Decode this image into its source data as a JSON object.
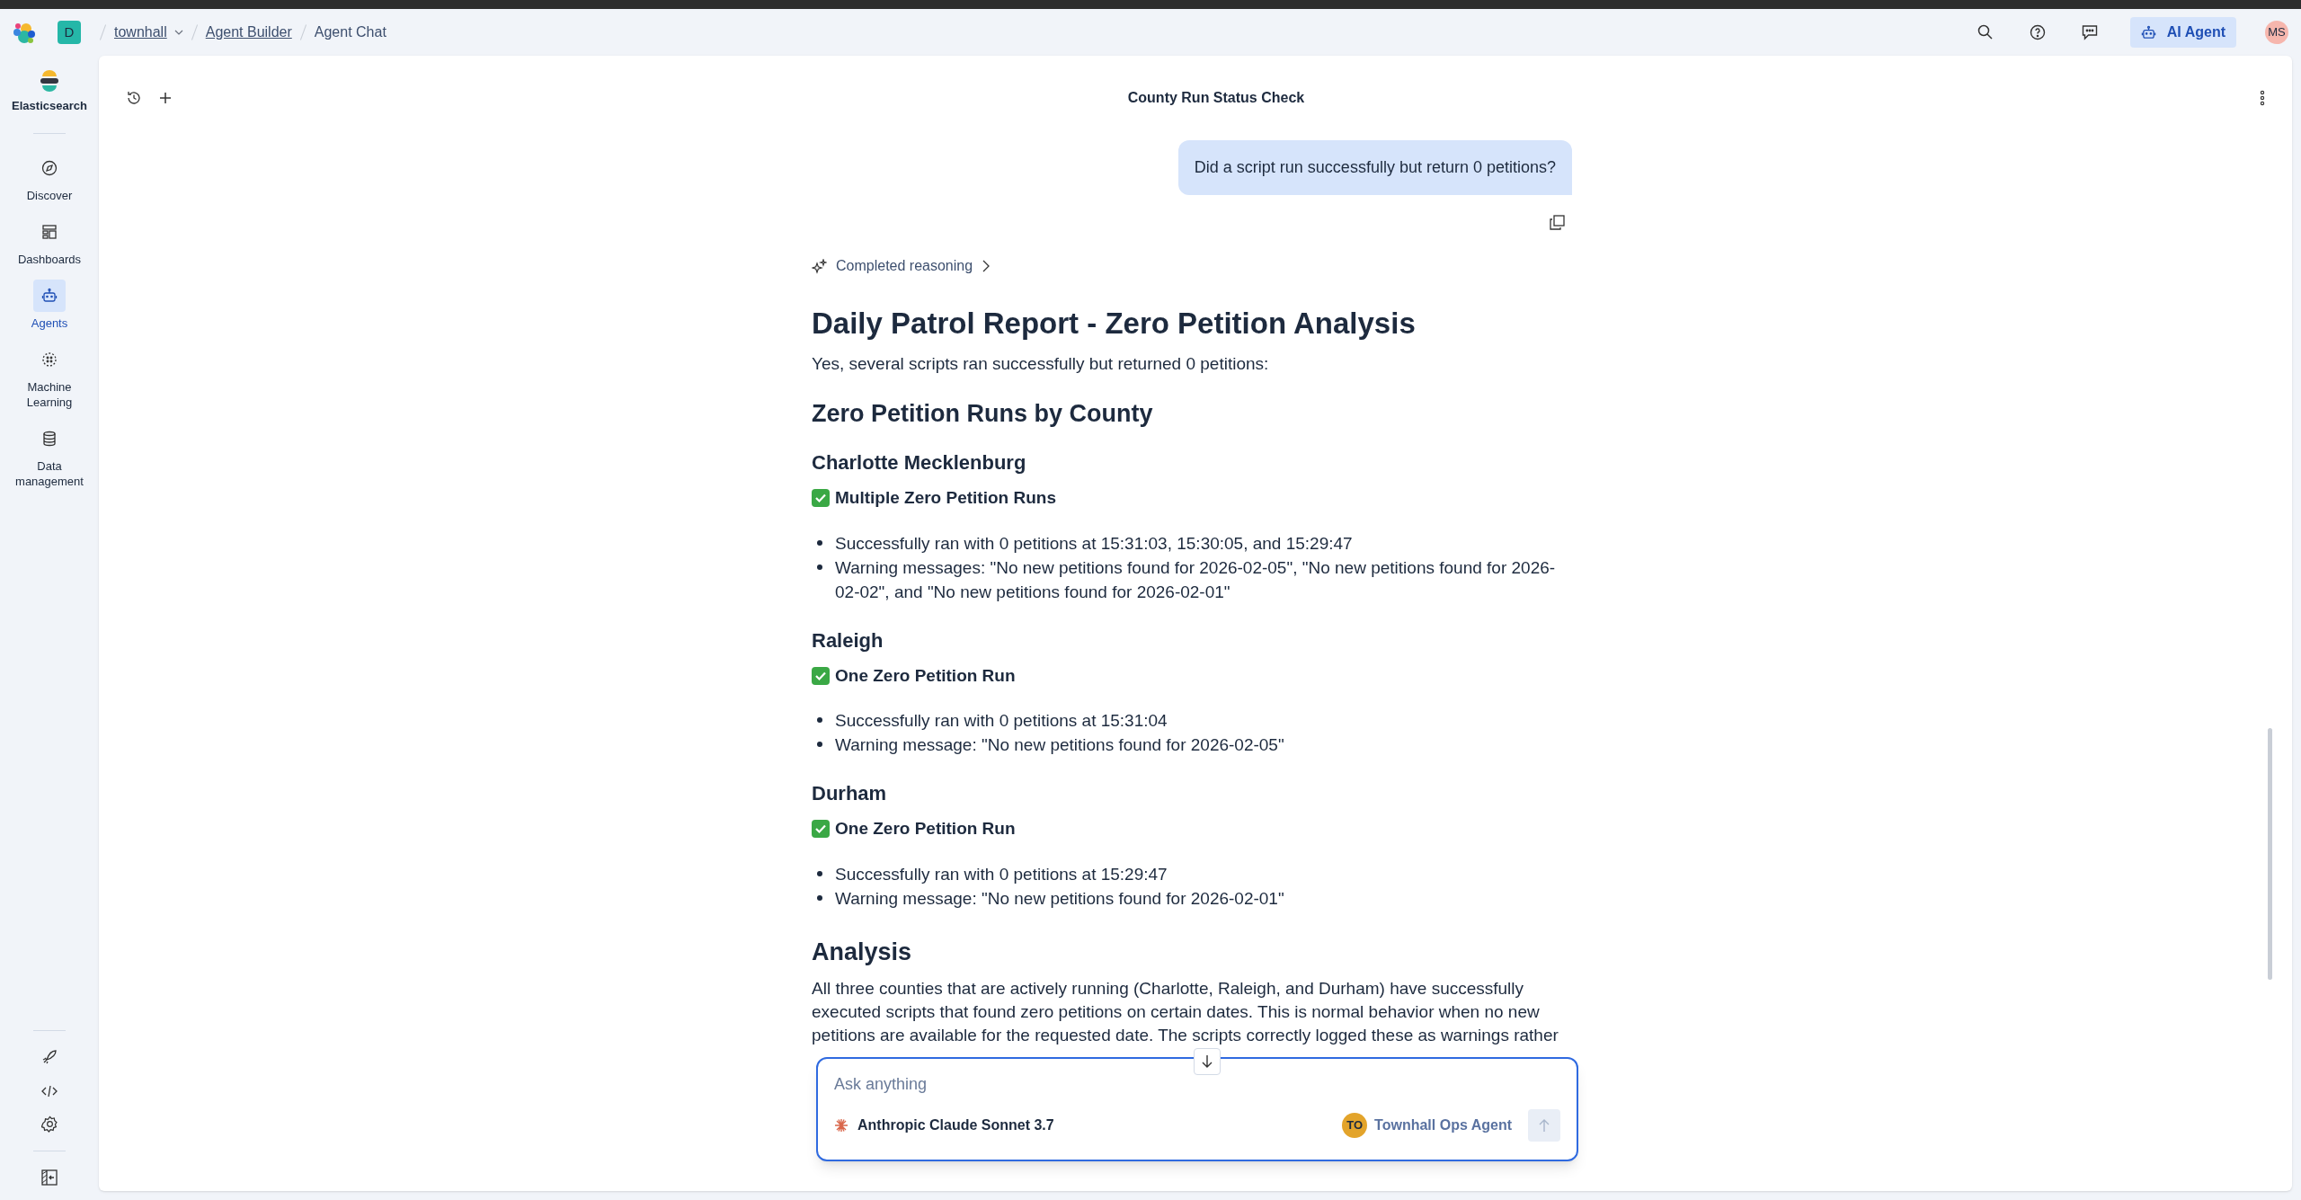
{
  "topbar": {
    "space_badge": "D",
    "breadcrumbs": [
      {
        "label": "townhall",
        "kind": "dropdown"
      },
      {
        "label": "Agent Builder",
        "kind": "link"
      },
      {
        "label": "Agent Chat",
        "kind": "current"
      }
    ],
    "ai_agent_button": "AI Agent",
    "avatar": "MS"
  },
  "sidebar": {
    "brand": "Elasticsearch",
    "items": [
      {
        "label": "Discover",
        "selected": false
      },
      {
        "label": "Dashboards",
        "selected": false
      },
      {
        "label": "Agents",
        "selected": true
      },
      {
        "label": "Machine Learning",
        "selected": false
      },
      {
        "label": "Data management",
        "selected": false
      }
    ]
  },
  "chat": {
    "title": "County Run Status Check",
    "user_message": "Did a script run successfully but return 0 petitions?",
    "reasoning": "Completed reasoning",
    "response": [
      {
        "kind": "h1",
        "text": "Daily Patrol Report - Zero Petition Analysis"
      },
      {
        "kind": "p",
        "text": "Yes, several scripts ran successfully but returned 0 petitions:"
      },
      {
        "kind": "h2",
        "text": "Zero Petition Runs by County"
      },
      {
        "kind": "h3",
        "text": "Charlotte Mecklenburg"
      },
      {
        "kind": "check",
        "text": "Multiple Zero Petition Runs"
      },
      {
        "kind": "bullets",
        "items": [
          "Successfully ran with 0 petitions at 15:31:03, 15:30:05, and 15:29:47",
          "Warning messages: \"No new petitions found for 2026-02-05\", \"No new petitions found for 2026-02-02\", and \"No new petitions found for 2026-02-01\""
        ]
      },
      {
        "kind": "h3",
        "text": "Raleigh"
      },
      {
        "kind": "check",
        "text": "One Zero Petition Run"
      },
      {
        "kind": "bullets",
        "items": [
          "Successfully ran with 0 petitions at 15:31:04",
          "Warning message: \"No new petitions found for 2026-02-05\""
        ]
      },
      {
        "kind": "h3",
        "text": "Durham"
      },
      {
        "kind": "check",
        "text": "One Zero Petition Run"
      },
      {
        "kind": "bullets",
        "items": [
          "Successfully ran with 0 petitions at 15:29:47",
          "Warning message: \"No new petitions found for 2026-02-01\""
        ]
      },
      {
        "kind": "h2",
        "text": "Analysis"
      },
      {
        "kind": "p",
        "text": "All three counties that are actively running (Charlotte, Raleigh, and Durham) have successfully executed scripts that found zero petitions on certain dates. This is normal behavior when no new petitions are available for the requested date. The scripts correctly logged these as warnings rather"
      }
    ]
  },
  "composer": {
    "placeholder": "Ask anything",
    "model": "Anthropic Claude Sonnet 3.7",
    "agent": {
      "initials": "TO",
      "name": "Townhall Ops Agent"
    }
  }
}
